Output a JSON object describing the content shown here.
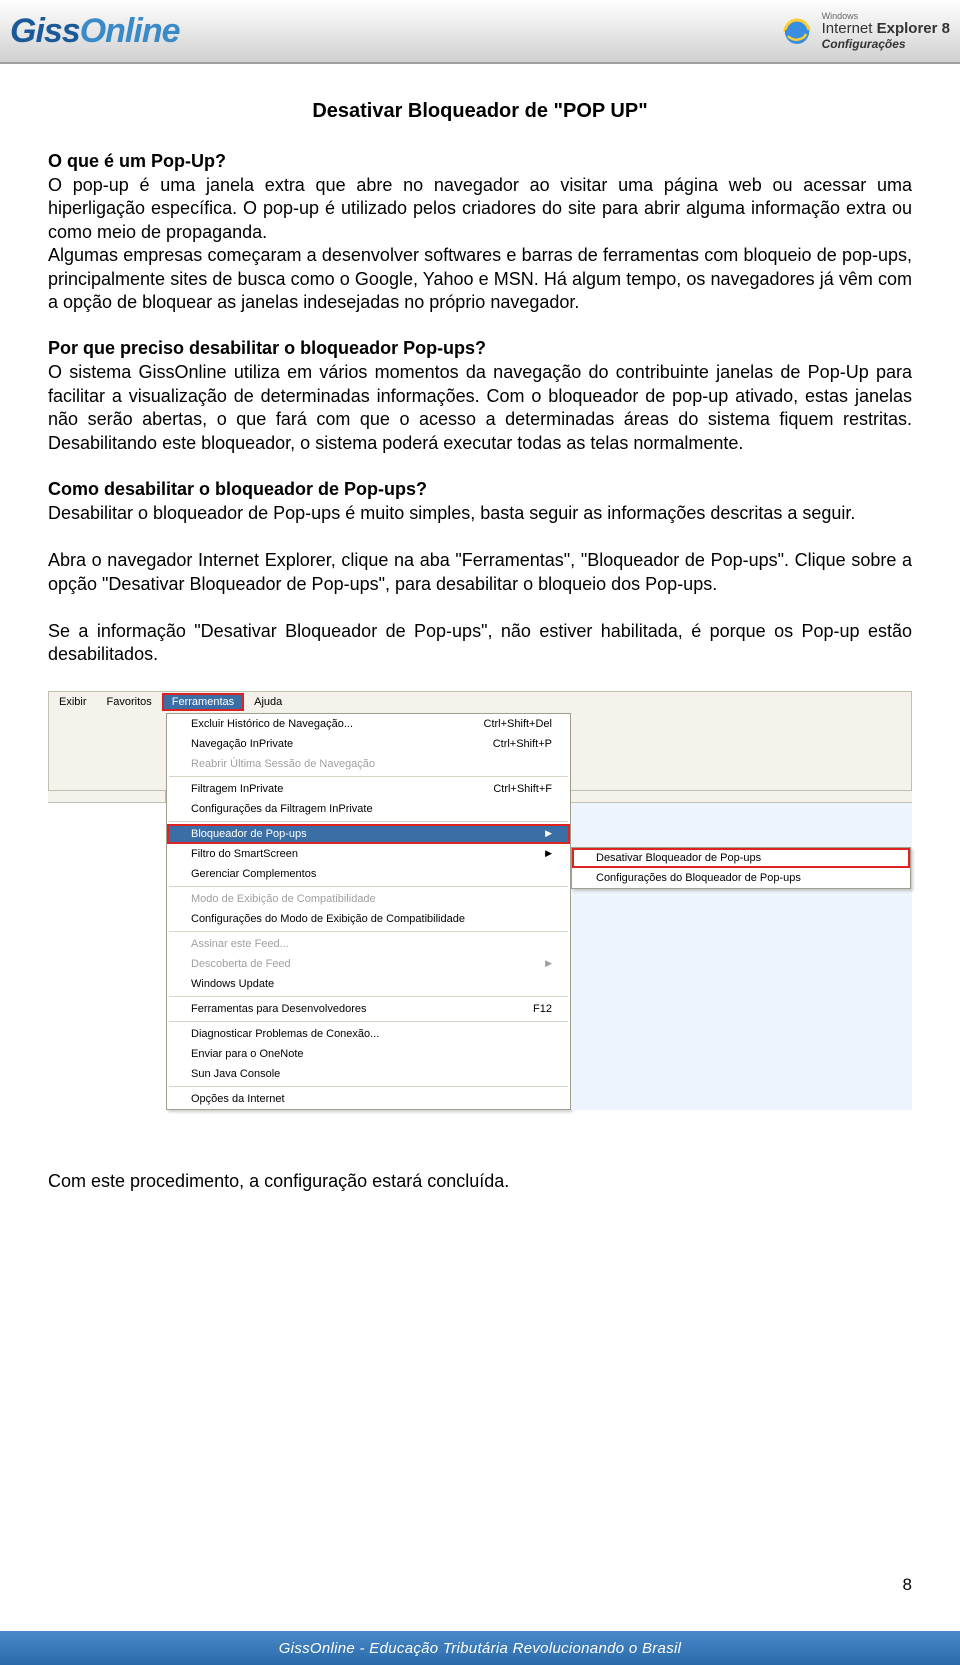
{
  "header": {
    "logo_giss": "Giss",
    "logo_online": "Online",
    "ie_windows": "Windows",
    "ie_name": "Internet ",
    "ie_explorer": "Explorer",
    "ie_ver": "8",
    "ie_conf": "Configurações"
  },
  "doc": {
    "title": "Desativar Bloqueador de \"POP UP\"",
    "q1_h": "O que é um Pop-Up?",
    "q1_p": "O pop-up é uma janela extra que abre no navegador ao visitar uma página web ou acessar uma hiperligação específica. O pop-up é utilizado pelos criadores do site para abrir alguma informação extra ou como meio de propaganda.",
    "q1_p2": "Algumas empresas começaram a desenvolver softwares e barras de ferramentas com bloqueio de pop-ups, principalmente sites de busca como o Google, Yahoo e MSN. Há algum tempo, os navegadores já vêm com a opção de bloquear as janelas indesejadas no próprio navegador.",
    "q2_h": "Por que preciso desabilitar o bloqueador Pop-ups?",
    "q2_p": "O sistema GissOnline utiliza em vários momentos da navegação do contribuinte janelas de Pop-Up para facilitar a visualização de determinadas informações. Com o bloqueador de pop-up ativado, estas janelas não serão abertas, o que fará com que o acesso a determinadas áreas do sistema fiquem restritas. Desabilitando este bloqueador, o sistema poderá executar todas as telas normalmente.",
    "q3_h": "Como desabilitar o bloqueador de Pop-ups?",
    "q3_p": "Desabilitar o bloqueador de Pop-ups é muito simples, basta seguir as informações descritas a seguir.",
    "step1": "Abra o navegador Internet Explorer, clique na aba \"Ferramentas\", \"Bloqueador de Pop-ups\". Clique sobre a opção \"Desativar Bloqueador de Pop-ups\", para desabilitar o bloqueio dos Pop-ups.",
    "step2": "Se a informação \"Desativar Bloqueador de Pop-ups\", não estiver habilitada, é porque os Pop-up estão desabilitados.",
    "conclusion": "Com este procedimento, a configuração estará concluída."
  },
  "screenshot": {
    "menubar": {
      "exibir": "Exibir",
      "favoritos": "Favoritos",
      "ferramentas": "Ferramentas",
      "ajuda": "Ajuda"
    },
    "dropdown": [
      {
        "label": "Excluir Histórico de Navegação...",
        "shortcut": "Ctrl+Shift+Del",
        "disabled": false,
        "arrow": false
      },
      {
        "label": "Navegação InPrivate",
        "shortcut": "Ctrl+Shift+P",
        "disabled": false,
        "arrow": false
      },
      {
        "label": "Reabrir Última Sessão de Navegação",
        "shortcut": "",
        "disabled": true,
        "arrow": false
      },
      {
        "sep": true
      },
      {
        "label": "Filtragem InPrivate",
        "shortcut": "Ctrl+Shift+F",
        "disabled": false,
        "arrow": false
      },
      {
        "label": "Configurações da Filtragem InPrivate",
        "shortcut": "",
        "disabled": false,
        "arrow": false
      },
      {
        "sep": true
      },
      {
        "label": "Bloqueador de Pop-ups",
        "shortcut": "",
        "disabled": false,
        "arrow": true,
        "highlight": true
      },
      {
        "label": "Filtro do SmartScreen",
        "shortcut": "",
        "disabled": false,
        "arrow": true
      },
      {
        "label": "Gerenciar Complementos",
        "shortcut": "",
        "disabled": false,
        "arrow": false
      },
      {
        "sep": true
      },
      {
        "label": "Modo de Exibição de Compatibilidade",
        "shortcut": "",
        "disabled": true,
        "arrow": false
      },
      {
        "label": "Configurações do Modo de Exibição de Compatibilidade",
        "shortcut": "",
        "disabled": false,
        "arrow": false
      },
      {
        "sep": true
      },
      {
        "label": "Assinar este Feed...",
        "shortcut": "",
        "disabled": true,
        "arrow": false
      },
      {
        "label": "Descoberta de Feed",
        "shortcut": "",
        "disabled": true,
        "arrow": true
      },
      {
        "label": "Windows Update",
        "shortcut": "",
        "disabled": false,
        "arrow": false
      },
      {
        "sep": true
      },
      {
        "label": "Ferramentas para Desenvolvedores",
        "shortcut": "F12",
        "disabled": false,
        "arrow": false
      },
      {
        "sep": true
      },
      {
        "label": "Diagnosticar Problemas de Conexão...",
        "shortcut": "",
        "disabled": false,
        "arrow": false
      },
      {
        "label": "Enviar para o OneNote",
        "shortcut": "",
        "disabled": false,
        "arrow": false
      },
      {
        "label": "Sun Java Console",
        "shortcut": "",
        "disabled": false,
        "arrow": false
      },
      {
        "sep": true
      },
      {
        "label": "Opções da Internet",
        "shortcut": "",
        "disabled": false,
        "arrow": false
      }
    ],
    "submenu": [
      "Desativar Bloqueador de Pop-ups",
      "Configurações do Bloqueador de Pop-ups"
    ]
  },
  "page_number": "8",
  "footer": "GissOnline - Educação Tributária Revolucionando o Brasil"
}
